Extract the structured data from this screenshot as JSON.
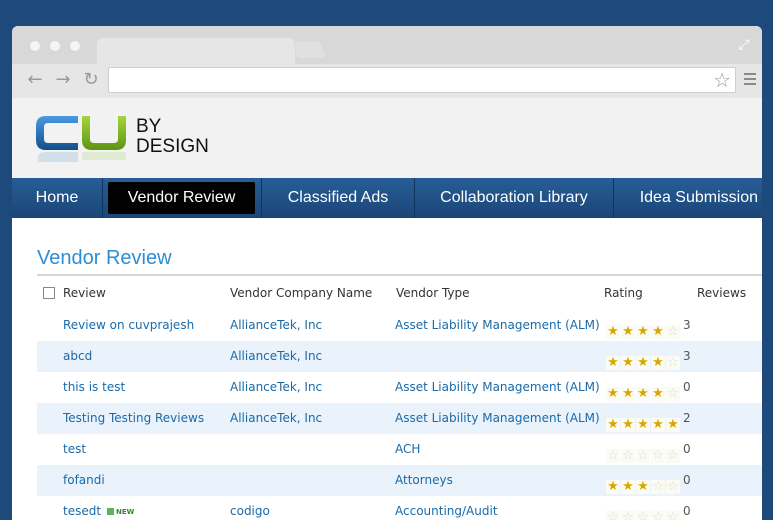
{
  "browser": {
    "address_value": "",
    "address_placeholder": ""
  },
  "logo": {
    "letters": "CU",
    "by": "BY",
    "design": "DESIGN"
  },
  "nav": {
    "items": [
      {
        "label": "Home"
      },
      {
        "label": "Vendor Review",
        "active": true
      },
      {
        "label": "Classified Ads"
      },
      {
        "label": "Collaboration Library"
      },
      {
        "label": "Idea Submission"
      }
    ]
  },
  "page": {
    "title": "Vendor Review"
  },
  "table": {
    "columns": [
      "Review",
      "Vendor Company Name",
      "Vendor Type",
      "Rating",
      "Reviews"
    ],
    "rows": [
      {
        "review": "Review on cuvprajesh",
        "company": "AllianceTek, Inc",
        "type": "Asset Liability Management (ALM)",
        "rating": 4,
        "reviews": "3"
      },
      {
        "review": "abcd",
        "company": "AllianceTek, Inc",
        "type": "",
        "rating": 4,
        "reviews": "3"
      },
      {
        "review": "this is test",
        "company": "AllianceTek, Inc",
        "type": "Asset Liability Management (ALM)",
        "rating": 4,
        "reviews": "0"
      },
      {
        "review": "Testing Testing Reviews",
        "company": "AllianceTek, Inc",
        "type": "Asset Liability Management (ALM)",
        "rating": 5,
        "reviews": "2"
      },
      {
        "review": "test",
        "company": "",
        "type": "ACH",
        "rating": 0,
        "reviews": "0"
      },
      {
        "review": "fofandi",
        "company": "",
        "type": "Attorneys",
        "rating": 3,
        "reviews": "0"
      },
      {
        "review": "tesedt",
        "badge": "NEW",
        "company": "codigo",
        "type": "Accounting/Audit",
        "rating": 0,
        "reviews": "0"
      }
    ]
  },
  "colors": {
    "page_background": "#1d4a7a",
    "nav_background": "#1f5188",
    "nav_active": "#020202",
    "title": "#2a8ed6",
    "link": "#1a6aa8",
    "star_on": "#d7a800",
    "logo_blue": "#1b6fb4",
    "logo_green": "#7ab51d"
  }
}
